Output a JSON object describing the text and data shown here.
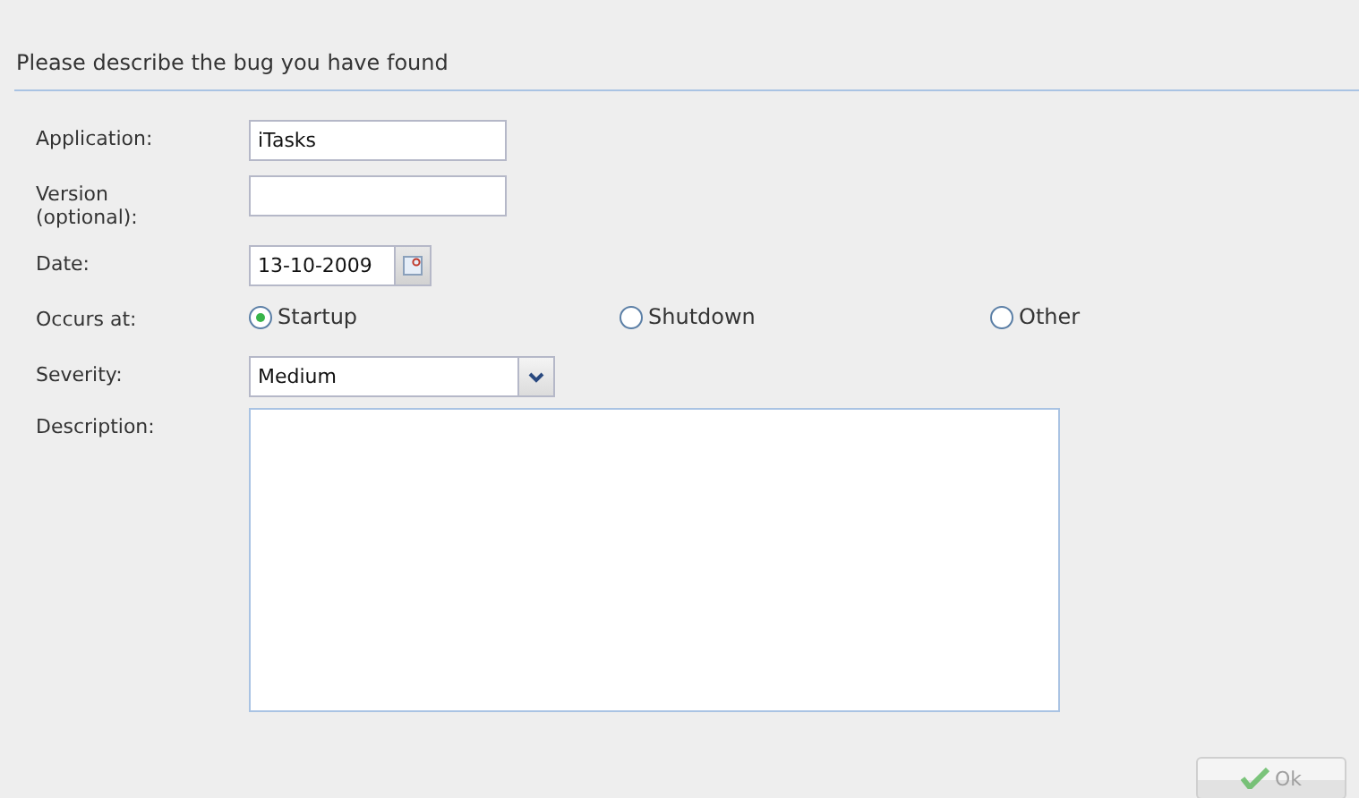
{
  "heading": "Please describe the bug you have found",
  "fields": [
    {
      "label": "Application:",
      "kind": "text",
      "value": "iTasks"
    },
    {
      "label": "Version (optional):",
      "kind": "text"
    },
    {
      "label": "Date:",
      "kind": "date",
      "value": "13-10-2009"
    },
    {
      "label": "Occurs at:",
      "kind": "radio",
      "options": [
        {
          "label": "Startup",
          "selected": true
        },
        {
          "label": "Shutdown",
          "selected": false
        },
        {
          "label": "Other",
          "selected": false
        }
      ]
    },
    {
      "label": "Severity:",
      "kind": "select",
      "value": "Medium"
    },
    {
      "label": "Description:",
      "kind": "textarea"
    }
  ],
  "ok_button": {
    "label": "Ok",
    "disabled": true
  }
}
